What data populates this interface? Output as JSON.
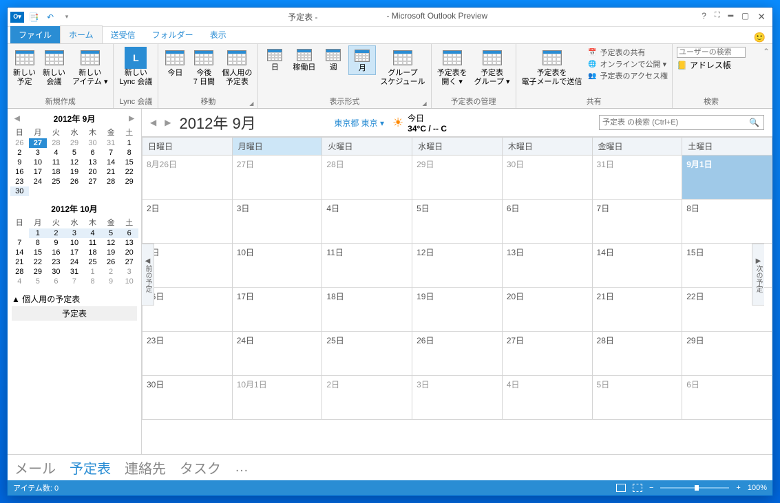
{
  "titlebar": {
    "doc": "予定表 -",
    "app": "- Microsoft Outlook Preview"
  },
  "tabs": {
    "file": "ファイル",
    "home": "ホーム",
    "sendreceive": "送受信",
    "folder": "フォルダー",
    "view": "表示"
  },
  "ribbon": {
    "new": {
      "label": "新規作成",
      "appt": "新しい\n予定",
      "meeting": "新しい\n会議",
      "items": "新しい\nアイテム ▾"
    },
    "lync": {
      "label": "Lync 会議",
      "btn": "新しい\nLync 会議"
    },
    "goto": {
      "label": "移動",
      "today": "今日",
      "next7": "今後\n7 日間",
      "personal": "個人用の\n予定表"
    },
    "arrange": {
      "label": "表示形式",
      "day": "日",
      "work": "稼働日",
      "week": "週",
      "month": "月",
      "sched": "グループ\nスケジュール"
    },
    "manage": {
      "label": "予定表の管理",
      "open": "予定表を\n開く ▾",
      "group": "予定表\nグループ ▾"
    },
    "share": {
      "label": "共有",
      "email": "予定表を\n電子メールで送信",
      "share_cal": "予定表の共有",
      "online": "オンラインで公開 ▾",
      "perm": "予定表のアクセス権"
    },
    "find": {
      "label": "検索",
      "user": "ユーザーの検索",
      "addr": "アドレス帳"
    }
  },
  "minical1": {
    "title": "2012年 9月",
    "dow": [
      "日",
      "月",
      "火",
      "水",
      "木",
      "金",
      "土"
    ],
    "rows": [
      [
        "26",
        "27",
        "28",
        "29",
        "30",
        "31",
        "1"
      ],
      [
        "2",
        "3",
        "4",
        "5",
        "6",
        "7",
        "8"
      ],
      [
        "9",
        "10",
        "11",
        "12",
        "13",
        "14",
        "15"
      ],
      [
        "16",
        "17",
        "18",
        "19",
        "20",
        "21",
        "22"
      ],
      [
        "23",
        "24",
        "25",
        "26",
        "27",
        "28",
        "29"
      ],
      [
        "30",
        "",
        "",
        "",
        "",
        "",
        ""
      ]
    ]
  },
  "minical2": {
    "title": "2012年 10月",
    "rows": [
      [
        "",
        "1",
        "2",
        "3",
        "4",
        "5",
        "6"
      ],
      [
        "7",
        "8",
        "9",
        "10",
        "11",
        "12",
        "13"
      ],
      [
        "14",
        "15",
        "16",
        "17",
        "18",
        "19",
        "20"
      ],
      [
        "21",
        "22",
        "23",
        "24",
        "25",
        "26",
        "27"
      ],
      [
        "28",
        "29",
        "30",
        "31",
        "1",
        "2",
        "3"
      ],
      [
        "4",
        "5",
        "6",
        "7",
        "8",
        "9",
        "10"
      ]
    ]
  },
  "callist": {
    "header": "▲ 個人用の予定表",
    "item": "予定表"
  },
  "mainhead": {
    "title": "2012年 9月",
    "location": "東京都 東京 ▾",
    "today_label": "今日",
    "temp": "34°C / -- C",
    "search_ph": "予定表 の検索 (Ctrl+E)"
  },
  "grid": {
    "dow": [
      "日曜日",
      "月曜日",
      "火曜日",
      "水曜日",
      "木曜日",
      "金曜日",
      "土曜日"
    ],
    "rows": [
      [
        "8月26日",
        "27日",
        "28日",
        "29日",
        "30日",
        "31日",
        "9月1日"
      ],
      [
        "2日",
        "3日",
        "4日",
        "5日",
        "6日",
        "7日",
        "8日"
      ],
      [
        "9日",
        "10日",
        "11日",
        "12日",
        "13日",
        "14日",
        "15日"
      ],
      [
        "16日",
        "17日",
        "18日",
        "19日",
        "20日",
        "21日",
        "22日"
      ],
      [
        "23日",
        "24日",
        "25日",
        "26日",
        "27日",
        "28日",
        "29日"
      ],
      [
        "30日",
        "10月1日",
        "2日",
        "3日",
        "4日",
        "5日",
        "6日"
      ]
    ],
    "prev": "前の予定",
    "next": "次の予定"
  },
  "nav": {
    "mail": "メール",
    "cal": "予定表",
    "people": "連絡先",
    "tasks": "タスク",
    "more": "…"
  },
  "status": {
    "items": "アイテム数: 0",
    "zoom": "100%"
  }
}
